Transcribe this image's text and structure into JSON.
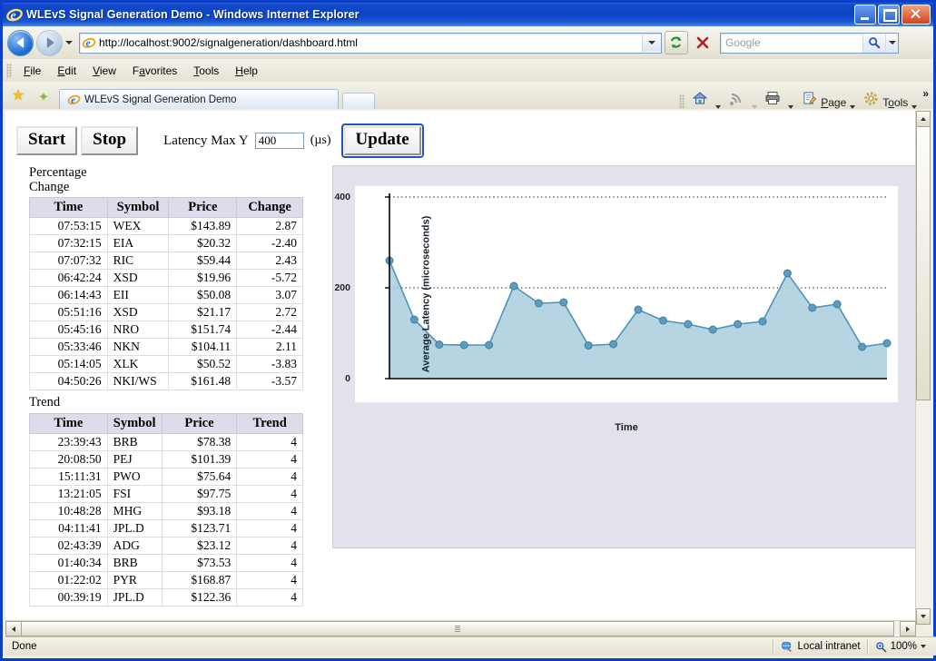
{
  "window": {
    "title": "WLEvS Signal Generation Demo - Windows Internet Explorer",
    "minimize_label": "Minimize",
    "maximize_label": "Maximize",
    "close_label": "Close"
  },
  "nav": {
    "back_label": "Back",
    "forward_label": "Forward",
    "url": "http://localhost:9002/signalgeneration/dashboard.html",
    "refresh_label": "Refresh",
    "stop_label": "Stop",
    "search_placeholder": "Google",
    "search_value": ""
  },
  "menu": {
    "items": [
      "File",
      "Edit",
      "View",
      "Favorites",
      "Tools",
      "Help"
    ]
  },
  "tabs": {
    "favorites_label": "Favorites Center",
    "add_favorite_label": "Add to Favorites",
    "items": [
      {
        "label": "WLEvS Signal Generation Demo"
      }
    ],
    "new_tab_label": "New Tab",
    "toolbar": [
      {
        "name": "home",
        "label": ""
      },
      {
        "name": "feeds",
        "label": ""
      },
      {
        "name": "print",
        "label": ""
      },
      {
        "name": "page",
        "label": "Page"
      },
      {
        "name": "tools",
        "label": "Tools"
      }
    ],
    "overflow_label": "»"
  },
  "app": {
    "start_label": "Start",
    "stop_label": "Stop",
    "latency_label": "Latency Max Y",
    "latency_value": "400",
    "latency_unit": "(µs)",
    "update_label": "Update"
  },
  "tables": [
    {
      "caption_line1": "Percentage",
      "caption_line2": "Change",
      "columns": [
        "Time",
        "Symbol",
        "Price",
        "Change"
      ],
      "rows": [
        [
          "07:53:15",
          "WEX",
          "$143.89",
          "2.87"
        ],
        [
          "07:32:15",
          "EIA",
          "$20.32",
          "-2.40"
        ],
        [
          "07:07:32",
          "RIC",
          "$59.44",
          "2.43"
        ],
        [
          "06:42:24",
          "XSD",
          "$19.96",
          "-5.72"
        ],
        [
          "06:14:43",
          "EII",
          "$50.08",
          "3.07"
        ],
        [
          "05:51:16",
          "XSD",
          "$21.17",
          "2.72"
        ],
        [
          "05:45:16",
          "NRO",
          "$151.74",
          "-2.44"
        ],
        [
          "05:33:46",
          "NKN",
          "$104.11",
          "2.11"
        ],
        [
          "05:14:05",
          "XLK",
          "$50.52",
          "-3.83"
        ],
        [
          "04:50:26",
          "NKI/WS",
          "$161.48",
          "-3.57"
        ]
      ]
    },
    {
      "caption_line1": "Trend",
      "caption_line2": "",
      "columns": [
        "Time",
        "Symbol",
        "Price",
        "Trend"
      ],
      "rows": [
        [
          "23:39:43",
          "BRB",
          "$78.38",
          "4"
        ],
        [
          "20:08:50",
          "PEJ",
          "$101.39",
          "4"
        ],
        [
          "15:11:31",
          "PWO",
          "$75.64",
          "4"
        ],
        [
          "13:21:05",
          "FSI",
          "$97.75",
          "4"
        ],
        [
          "10:48:28",
          "MHG",
          "$93.18",
          "4"
        ],
        [
          "04:11:41",
          "JPL.D",
          "$123.71",
          "4"
        ],
        [
          "02:43:39",
          "ADG",
          "$23.12",
          "4"
        ],
        [
          "01:40:34",
          "BRB",
          "$73.53",
          "4"
        ],
        [
          "01:22:02",
          "PYR",
          "$168.87",
          "4"
        ],
        [
          "00:39:19",
          "JPL.D",
          "$122.36",
          "4"
        ]
      ]
    }
  ],
  "chart_data": {
    "type": "area",
    "title": "",
    "xlabel": "Time",
    "ylabel": "Average Latency (microseconds)",
    "ylim": [
      0,
      400
    ],
    "yticks": [
      0,
      200,
      400
    ],
    "grid": true,
    "legend": null,
    "line_color": "#4f93b8",
    "fill_color": "#a9cddd",
    "marker_color": "#5b9dc0",
    "x": [
      0,
      1,
      2,
      3,
      4,
      5,
      6,
      7,
      8,
      9,
      10,
      11,
      12,
      13,
      14,
      15,
      16,
      17,
      18,
      19,
      20
    ],
    "values": [
      260,
      130,
      75,
      74,
      74,
      204,
      166,
      168,
      73,
      76,
      152,
      128,
      120,
      108,
      120,
      126,
      232,
      156,
      164,
      70,
      78
    ]
  },
  "status": {
    "message": "Done",
    "zone": "Local intranet",
    "zoom": "100%"
  }
}
